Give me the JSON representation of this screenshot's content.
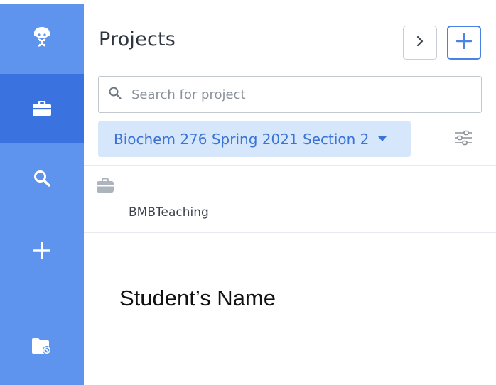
{
  "rail": {
    "items": [
      {
        "icon": "dna-avatar-icon"
      },
      {
        "icon": "briefcase-icon",
        "active": true
      },
      {
        "icon": "search-icon"
      },
      {
        "icon": "plus-icon"
      },
      {
        "icon": "folder-icon"
      }
    ]
  },
  "panel": {
    "title": "Projects",
    "next_button_glyph": ">",
    "add_button_glyph": "+"
  },
  "search": {
    "placeholder": "Search for project",
    "value": ""
  },
  "section_filter": {
    "selected": "Biochem 276 Spring 2021 Section 2"
  },
  "projects": [
    {
      "name": "BMBTeaching",
      "icon": "briefcase-icon"
    }
  ],
  "overlay": {
    "student_name": "Student’s Name"
  },
  "colors": {
    "rail": "#5e93ee",
    "rail_active": "#3a73e0",
    "accent": "#4a82e6",
    "chip_bg": "#d6e6fb",
    "chip_text": "#3c74d6"
  }
}
